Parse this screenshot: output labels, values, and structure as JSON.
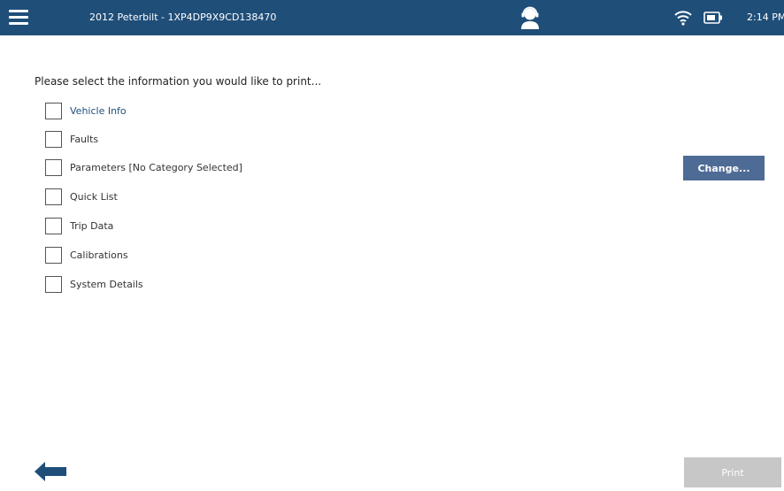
{
  "header": {
    "vehicle_title": "2012 Peterbilt - 1XP4DP9X9CD138470",
    "time": "2:14 PM",
    "icons": [
      "menu-icon",
      "support-agent-icon",
      "wifi-icon",
      "battery-icon"
    ]
  },
  "main": {
    "prompt": "Please select the information you would like to print...",
    "options": [
      {
        "label": "Vehicle Info",
        "checked": false
      },
      {
        "label": "Faults",
        "checked": false
      },
      {
        "label": "Parameters [No Category Selected]",
        "checked": false
      },
      {
        "label": "Quick List",
        "checked": false
      },
      {
        "label": "Trip Data",
        "checked": false
      },
      {
        "label": "Calibrations",
        "checked": false
      },
      {
        "label": "System Details",
        "checked": false
      }
    ],
    "change_label": "Change...",
    "print_label": "Print"
  },
  "colors": {
    "header_bg": "#1f4e79",
    "accent_button": "#4e6b96",
    "disabled_button": "#c7c7c7"
  }
}
